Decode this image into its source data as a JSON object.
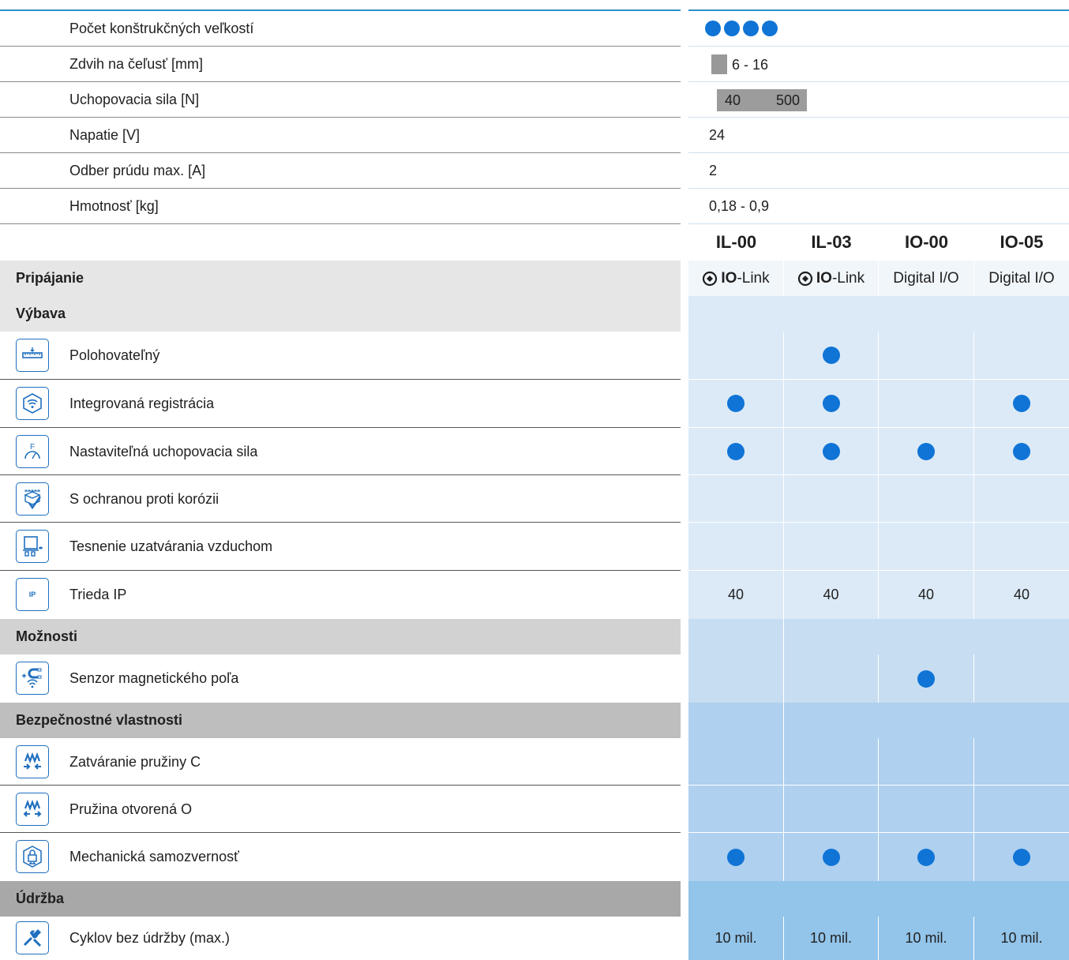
{
  "summary": [
    {
      "label": "Počet konštrukčných veľkostí"
    },
    {
      "label": "Zdvih na čeľusť [mm]",
      "value": "6 - 16"
    },
    {
      "label": "Uchopovacia sila [N]",
      "min": "40",
      "max": "500"
    },
    {
      "label": "Napatie [V]",
      "value": "24"
    },
    {
      "label": "Odber prúdu max. [A]",
      "value": "2"
    },
    {
      "label": "Hmotnosť [kg]",
      "value": "0,18 - 0,9"
    }
  ],
  "size_count_dots": 4,
  "variants": [
    "IL-00",
    "IL-03",
    "IO-00",
    "IO-05"
  ],
  "connection": {
    "label": "Pripájanie",
    "values": [
      "Link",
      "Link",
      "Digital I/O",
      "Digital I/O"
    ],
    "io_prefix": "IO",
    "io_link_suffix": "-Link"
  },
  "sections": {
    "equipment": "Výbava",
    "options": "Možnosti",
    "safety": "Bezpečnostné vlastnosti",
    "maintenance": "Údržba"
  },
  "features": {
    "positionable": {
      "label": "Polohovateľný",
      "icon": "ruler-icon",
      "marks": [
        false,
        true,
        false,
        false
      ]
    },
    "integrated_sensing": {
      "label": "Integrovaná registrácia",
      "icon": "wifi-sensor-icon",
      "marks": [
        true,
        true,
        false,
        true
      ]
    },
    "adjustable_force": {
      "label": "Nastaviteľná uchopovacia sila",
      "icon": "force-gauge-icon",
      "marks": [
        true,
        true,
        true,
        true
      ]
    },
    "corrosion": {
      "label": "S ochranou proti korózii",
      "icon": "corrosion-shield-icon",
      "marks": [
        false,
        false,
        false,
        false
      ]
    },
    "sealing_air": {
      "label": "Tesnenie uzatvárania vzduchom",
      "icon": "sealing-air-icon",
      "marks": [
        false,
        false,
        false,
        false
      ]
    },
    "ip": {
      "label": "Trieda IP",
      "icon": "ip-icon",
      "icon_text": "IP",
      "values": [
        "40",
        "40",
        "40",
        "40"
      ]
    },
    "magnetic_sensor": {
      "label": "Senzor magnetického poľa",
      "icon": "magnet-sensor-icon",
      "marks": [
        false,
        false,
        true,
        false
      ]
    },
    "spring_close": {
      "label": "Zatváranie pružiny C",
      "icon": "spring-close-icon",
      "marks": [
        false,
        false,
        false,
        false
      ]
    },
    "spring_open": {
      "label": "Pružina otvorená O",
      "icon": "spring-open-icon",
      "marks": [
        false,
        false,
        false,
        false
      ]
    },
    "self_locking": {
      "label": "Mechanická samozvernosť",
      "icon": "lock-icon",
      "marks": [
        true,
        true,
        true,
        true
      ]
    },
    "cycles": {
      "label": "Cyklov bez údržby (max.)",
      "icon": "maintenance-tools-icon",
      "values": [
        "10 mil.",
        "10 mil.",
        "10 mil.",
        "10 mil."
      ]
    }
  },
  "colors": {
    "accent_blue": "#0f74d6",
    "header_line": "#2f8fcc",
    "connection_row_bg": "#f1f6fb",
    "equipment_bg": "#dceaf7",
    "options_bg": "#c7ddf1",
    "safety_bg": "#afd0ef",
    "maintenance_bg": "#93c4ea",
    "equipment_head_left": "#e6e6e6",
    "options_head_left": "#d2d2d2",
    "safety_head_left": "#bebebe",
    "maintenance_head_left": "#a8a8a8"
  }
}
